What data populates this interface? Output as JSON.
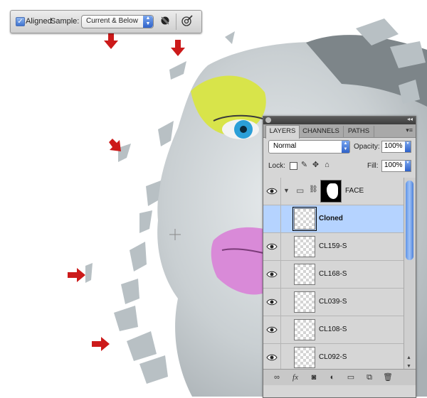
{
  "options_bar": {
    "aligned_checked": true,
    "aligned_label": "Aligned",
    "sample_label": "Sample:",
    "sample_value": "Current & Below",
    "ignore_adjustment_icon": "ignore-adjustment-layers-icon",
    "pressure_icon": "pressure-size-icon"
  },
  "layers_panel": {
    "tabs": [
      {
        "label": "LAYERS",
        "active": true
      },
      {
        "label": "CHANNELS",
        "active": false
      },
      {
        "label": "PATHS",
        "active": false
      }
    ],
    "blend_mode": "Normal",
    "opacity_label": "Opacity:",
    "opacity_value": "100%",
    "lock_label": "Lock:",
    "fill_label": "Fill:",
    "fill_value": "100%",
    "layers": [
      {
        "name": "FACE",
        "type": "group",
        "visible": true,
        "selected": false
      },
      {
        "name": "Cloned",
        "type": "layer",
        "visible": false,
        "selected": true
      },
      {
        "name": "CL159-S",
        "type": "layer",
        "visible": true,
        "selected": false
      },
      {
        "name": "CL168-S",
        "type": "layer",
        "visible": true,
        "selected": false
      },
      {
        "name": "CL039-S",
        "type": "layer",
        "visible": true,
        "selected": false
      },
      {
        "name": "CL108-S",
        "type": "layer",
        "visible": true,
        "selected": false
      },
      {
        "name": "CL092-S",
        "type": "layer",
        "visible": true,
        "selected": false
      }
    ]
  },
  "colors": {
    "accent_blue": "#3f74d0",
    "selection": "#b5d3ff",
    "arrow_red": "#cc1a1a",
    "eyeshadow": "#d8e44a",
    "lips": "#d98ad8",
    "iris": "#2b9fd8"
  }
}
